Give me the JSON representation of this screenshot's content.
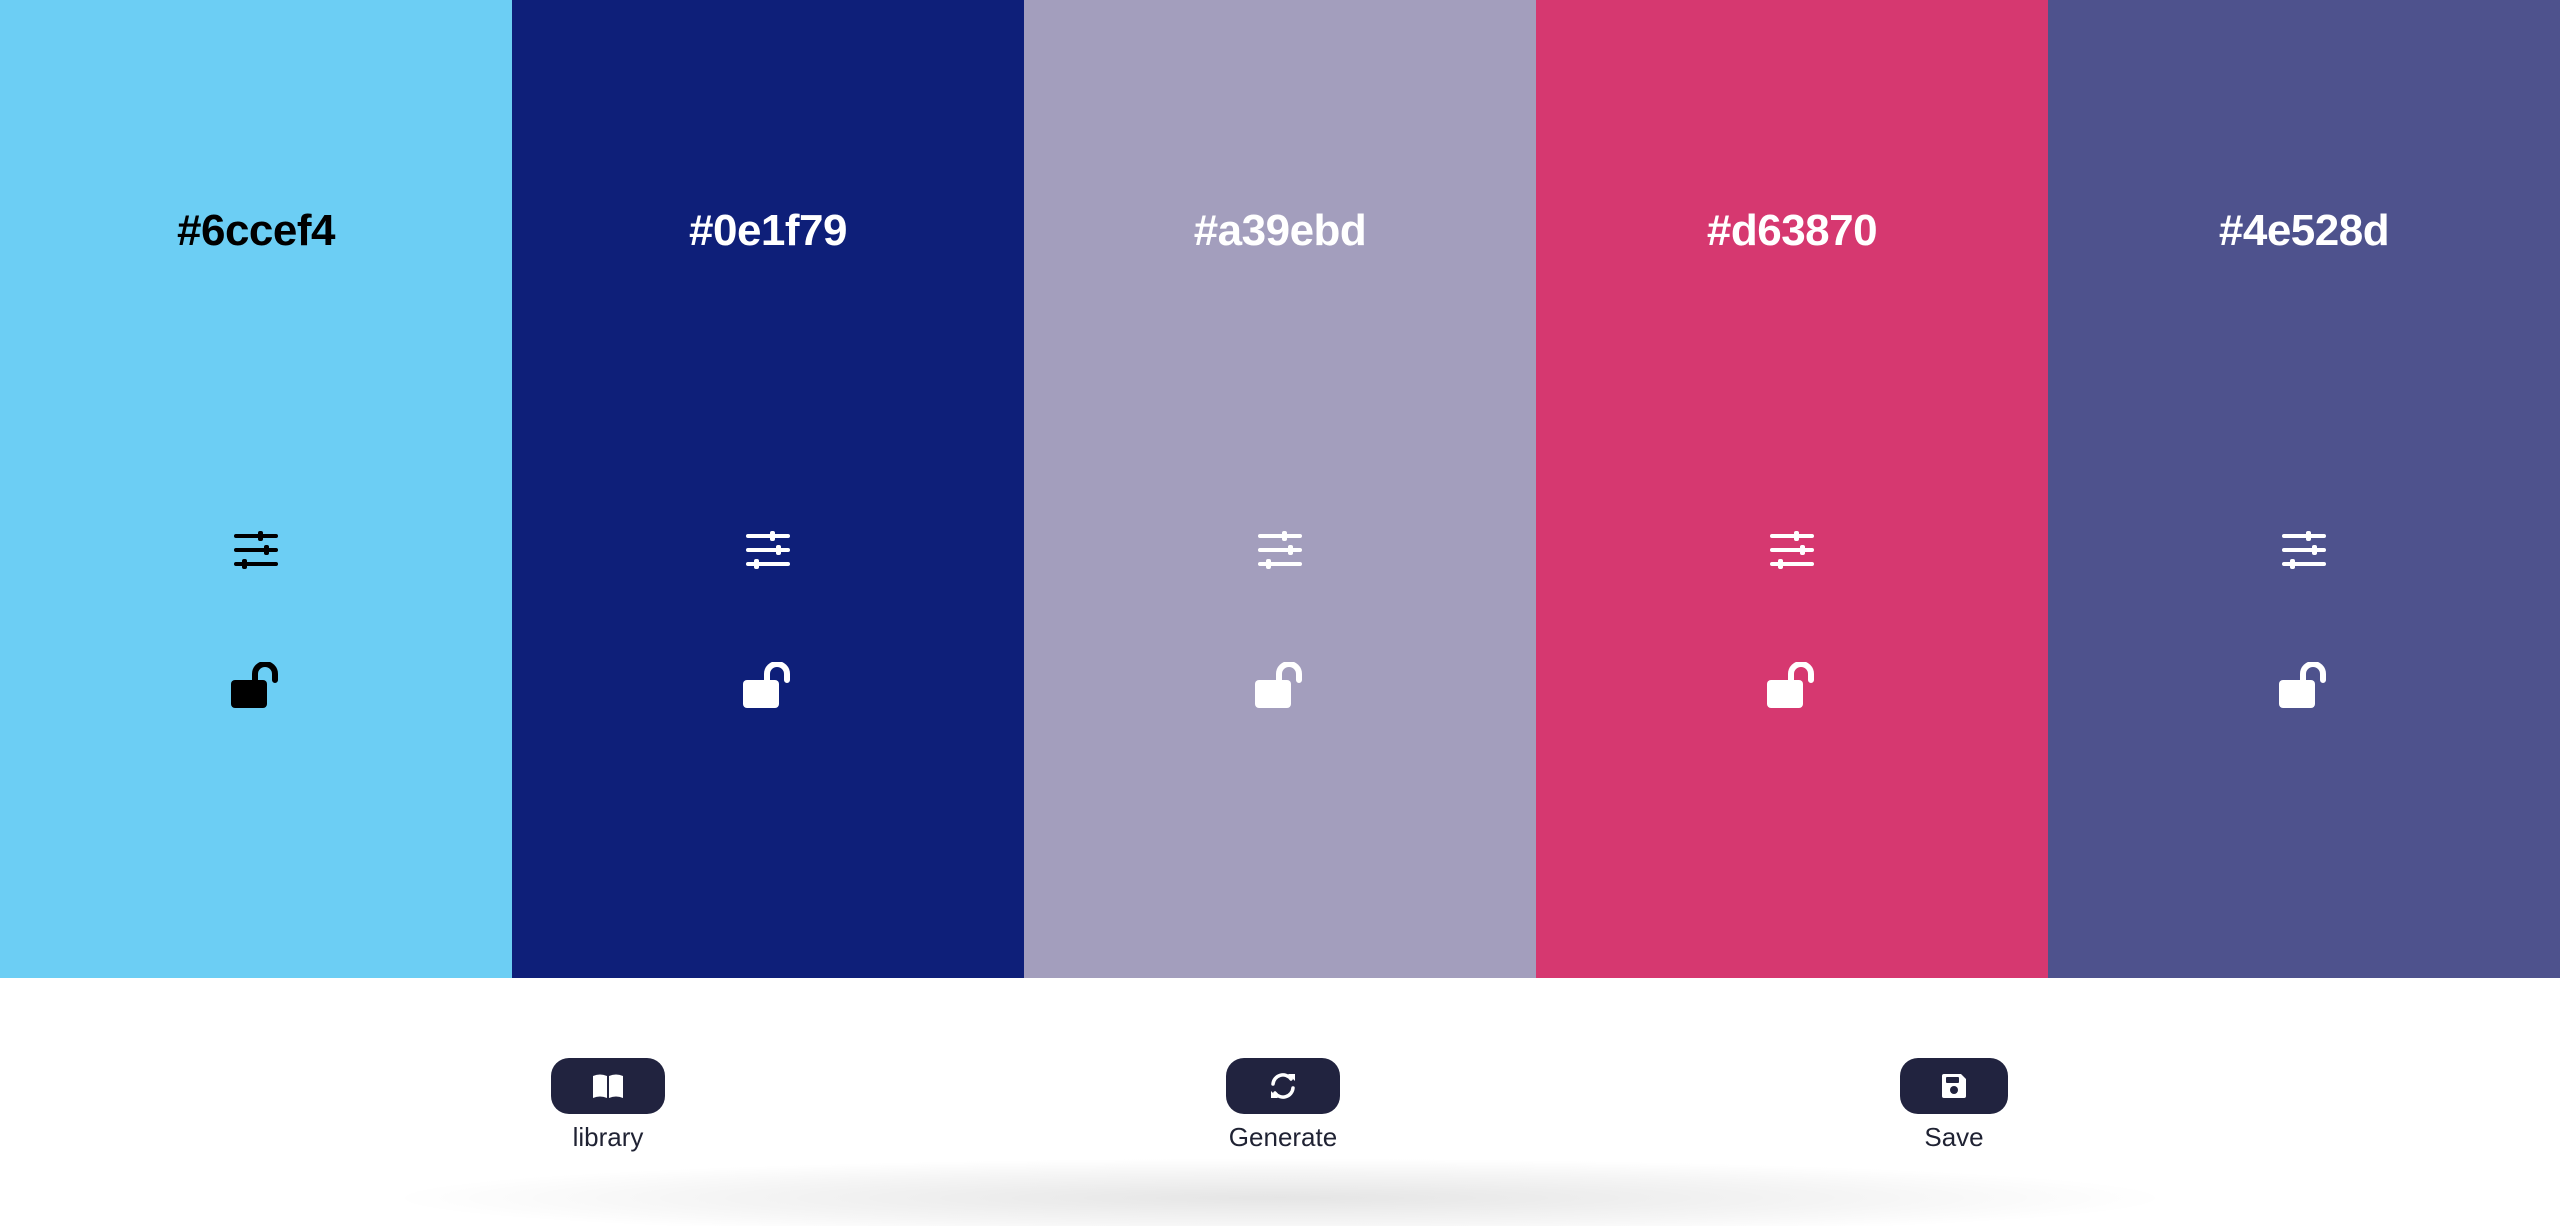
{
  "palette": {
    "swatches": [
      {
        "hex": "#6ccef4",
        "color": "#6ccef4",
        "text_color": "#000000",
        "adjust_icon": "sliders-icon",
        "lock_icon": "unlock-icon",
        "locked": false
      },
      {
        "hex": "#0e1f79",
        "color": "#0e1f79",
        "text_color": "#ffffff",
        "adjust_icon": "sliders-icon",
        "lock_icon": "unlock-icon",
        "locked": false
      },
      {
        "hex": "#a39ebd",
        "color": "#a39ebd",
        "text_color": "#ffffff",
        "adjust_icon": "sliders-icon",
        "lock_icon": "unlock-icon",
        "locked": false
      },
      {
        "hex": "#d63870",
        "color": "#d63870",
        "text_color": "#ffffff",
        "adjust_icon": "sliders-icon",
        "lock_icon": "unlock-icon",
        "locked": false
      },
      {
        "hex": "#4e528d",
        "color": "#4e528d",
        "text_color": "#ffffff",
        "adjust_icon": "sliders-icon",
        "lock_icon": "unlock-icon",
        "locked": false
      }
    ]
  },
  "toolbar": {
    "button_color": "#21233f",
    "icon_color": "#ffffff",
    "library": {
      "label": "library",
      "icon": "book-open-icon"
    },
    "generate": {
      "label": "Generate",
      "icon": "refresh-icon"
    },
    "save": {
      "label": "Save",
      "icon": "floppy-disk-icon"
    }
  }
}
